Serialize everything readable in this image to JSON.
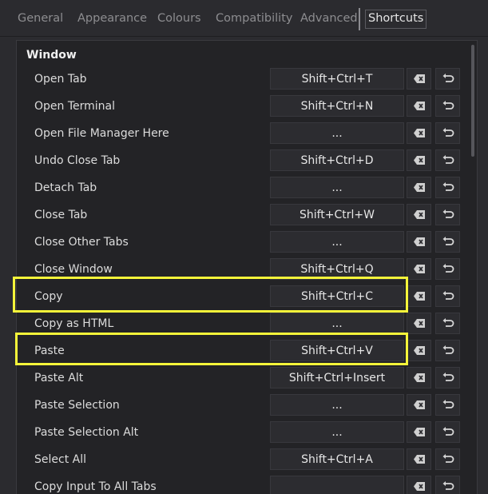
{
  "tabs": [
    {
      "label": "General",
      "active": false
    },
    {
      "label": "Appearance",
      "active": false
    },
    {
      "label": "Colours",
      "active": false
    },
    {
      "label": "Compatibility",
      "active": false
    },
    {
      "label": "Advanced",
      "active": false
    },
    {
      "label": "Shortcuts",
      "active": true
    }
  ],
  "group": {
    "title": "Window"
  },
  "shortcuts": [
    {
      "label": "Open Tab",
      "value": "Shift+Ctrl+T"
    },
    {
      "label": "Open Terminal",
      "value": "Shift+Ctrl+N"
    },
    {
      "label": "Open File Manager Here",
      "value": "..."
    },
    {
      "label": "Undo Close Tab",
      "value": "Shift+Ctrl+D"
    },
    {
      "label": "Detach Tab",
      "value": "..."
    },
    {
      "label": "Close Tab",
      "value": "Shift+Ctrl+W"
    },
    {
      "label": "Close Other Tabs",
      "value": "..."
    },
    {
      "label": "Close Window",
      "value": "Shift+Ctrl+Q"
    },
    {
      "label": "Copy",
      "value": "Shift+Ctrl+C",
      "highlighted": true
    },
    {
      "label": "Copy as HTML",
      "value": "..."
    },
    {
      "label": "Paste",
      "value": "Shift+Ctrl+V",
      "highlighted": true
    },
    {
      "label": "Paste Alt",
      "value": "Shift+Ctrl+Insert"
    },
    {
      "label": "Paste Selection",
      "value": "..."
    },
    {
      "label": "Paste Selection Alt",
      "value": "..."
    },
    {
      "label": "Select All",
      "value": "Shift+Ctrl+A"
    },
    {
      "label": "Copy Input To All Tabs",
      "value": ""
    }
  ],
  "icons": {
    "clear": "backspace-clear-icon",
    "reset": "undo-reset-icon"
  },
  "colors": {
    "highlight": "#f5f53a",
    "background": "#2b2b2f",
    "panel": "#232326"
  }
}
